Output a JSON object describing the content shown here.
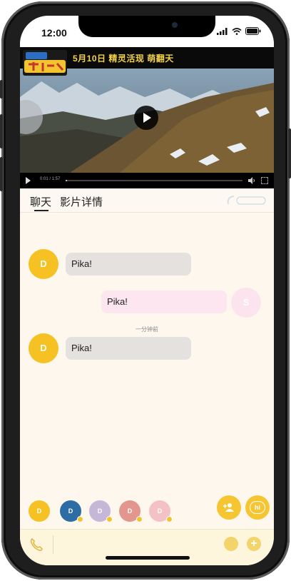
{
  "status_bar": {
    "time": "12:00"
  },
  "video": {
    "logo_text": "大绒雾 皮卡丘",
    "banner_text": "5月10日 精灵活现 萌翻天",
    "time_display": "0:01 / 1:57",
    "progress": 0.01
  },
  "tabs": [
    {
      "label": "聊天",
      "active": true
    },
    {
      "label": "影片详情",
      "active": false
    }
  ],
  "messages": [
    {
      "sender": "D",
      "side": "left",
      "text": "Pika!",
      "avatar_color": "#f6c223",
      "bubble_color": "#e5e1df"
    },
    {
      "sender": "S",
      "side": "right",
      "text": "Pika!",
      "avatar_color": "#fce4ee",
      "bubble_color": "#fde6ef"
    },
    {
      "timestamp": "一分钟前"
    },
    {
      "sender": "D",
      "side": "left",
      "text": "Pika!",
      "avatar_color": "#f6c223",
      "bubble_color": "#e5e1df"
    }
  ],
  "participants": [
    {
      "initial": "D",
      "color": "#f6c223"
    },
    {
      "initial": "D",
      "color": "#2c6da6"
    },
    {
      "initial": "D",
      "color": "#c6b6d8"
    },
    {
      "initial": "D",
      "color": "#e3968d"
    },
    {
      "initial": "D",
      "color": "#f4c1c7"
    }
  ],
  "fab": {
    "hi_label": "hi"
  },
  "input": {
    "placeholder": ""
  },
  "colors": {
    "accent": "#f6c532",
    "bg": "#fdf7ee"
  }
}
